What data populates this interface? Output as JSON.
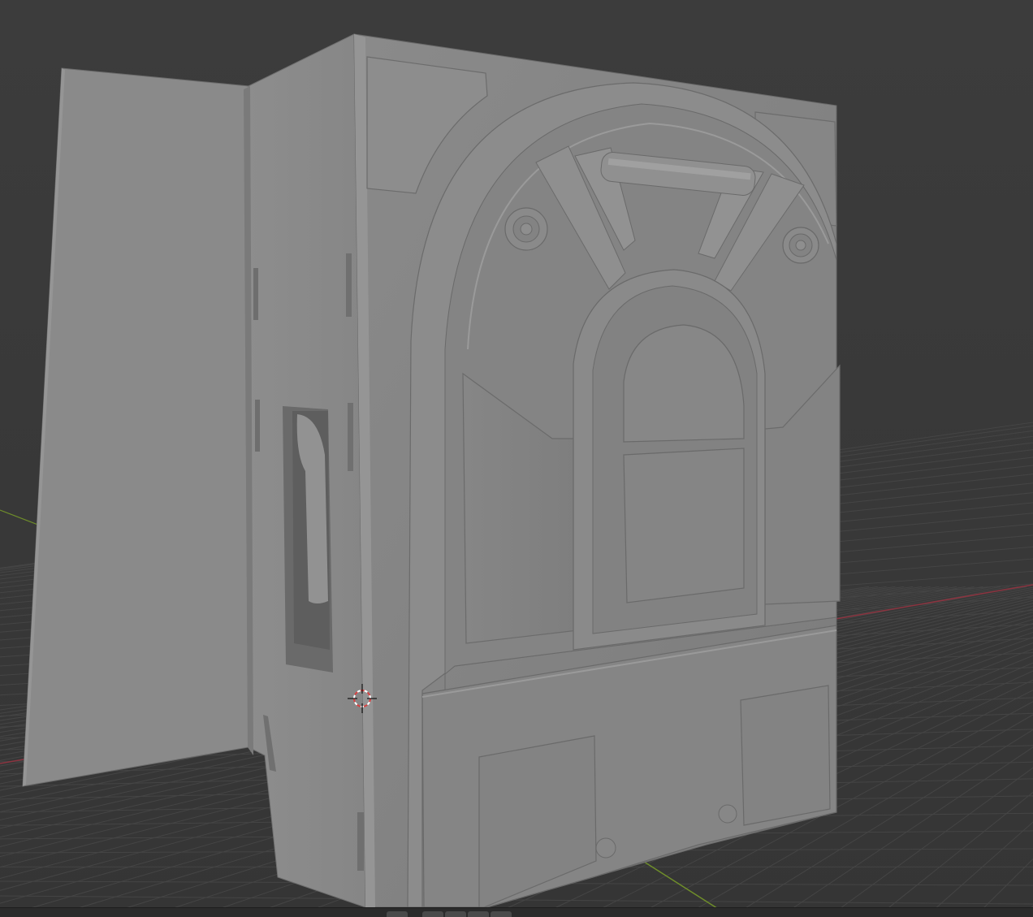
{
  "app": {
    "name": "3D viewport",
    "view": "solid-shading"
  },
  "colors": {
    "background": "#3a3a3a",
    "grid_line": "#4a4a4a",
    "x_axis": "#9a3a45",
    "y_axis": "#6f8e2a",
    "mesh_light": "#8e8e8e",
    "mesh_mid": "#838383",
    "mesh_dark": "#6f6f6f",
    "bottom_strip": "#2b2b2b"
  },
  "icons": {
    "cursor": "3d-cursor-icon"
  }
}
